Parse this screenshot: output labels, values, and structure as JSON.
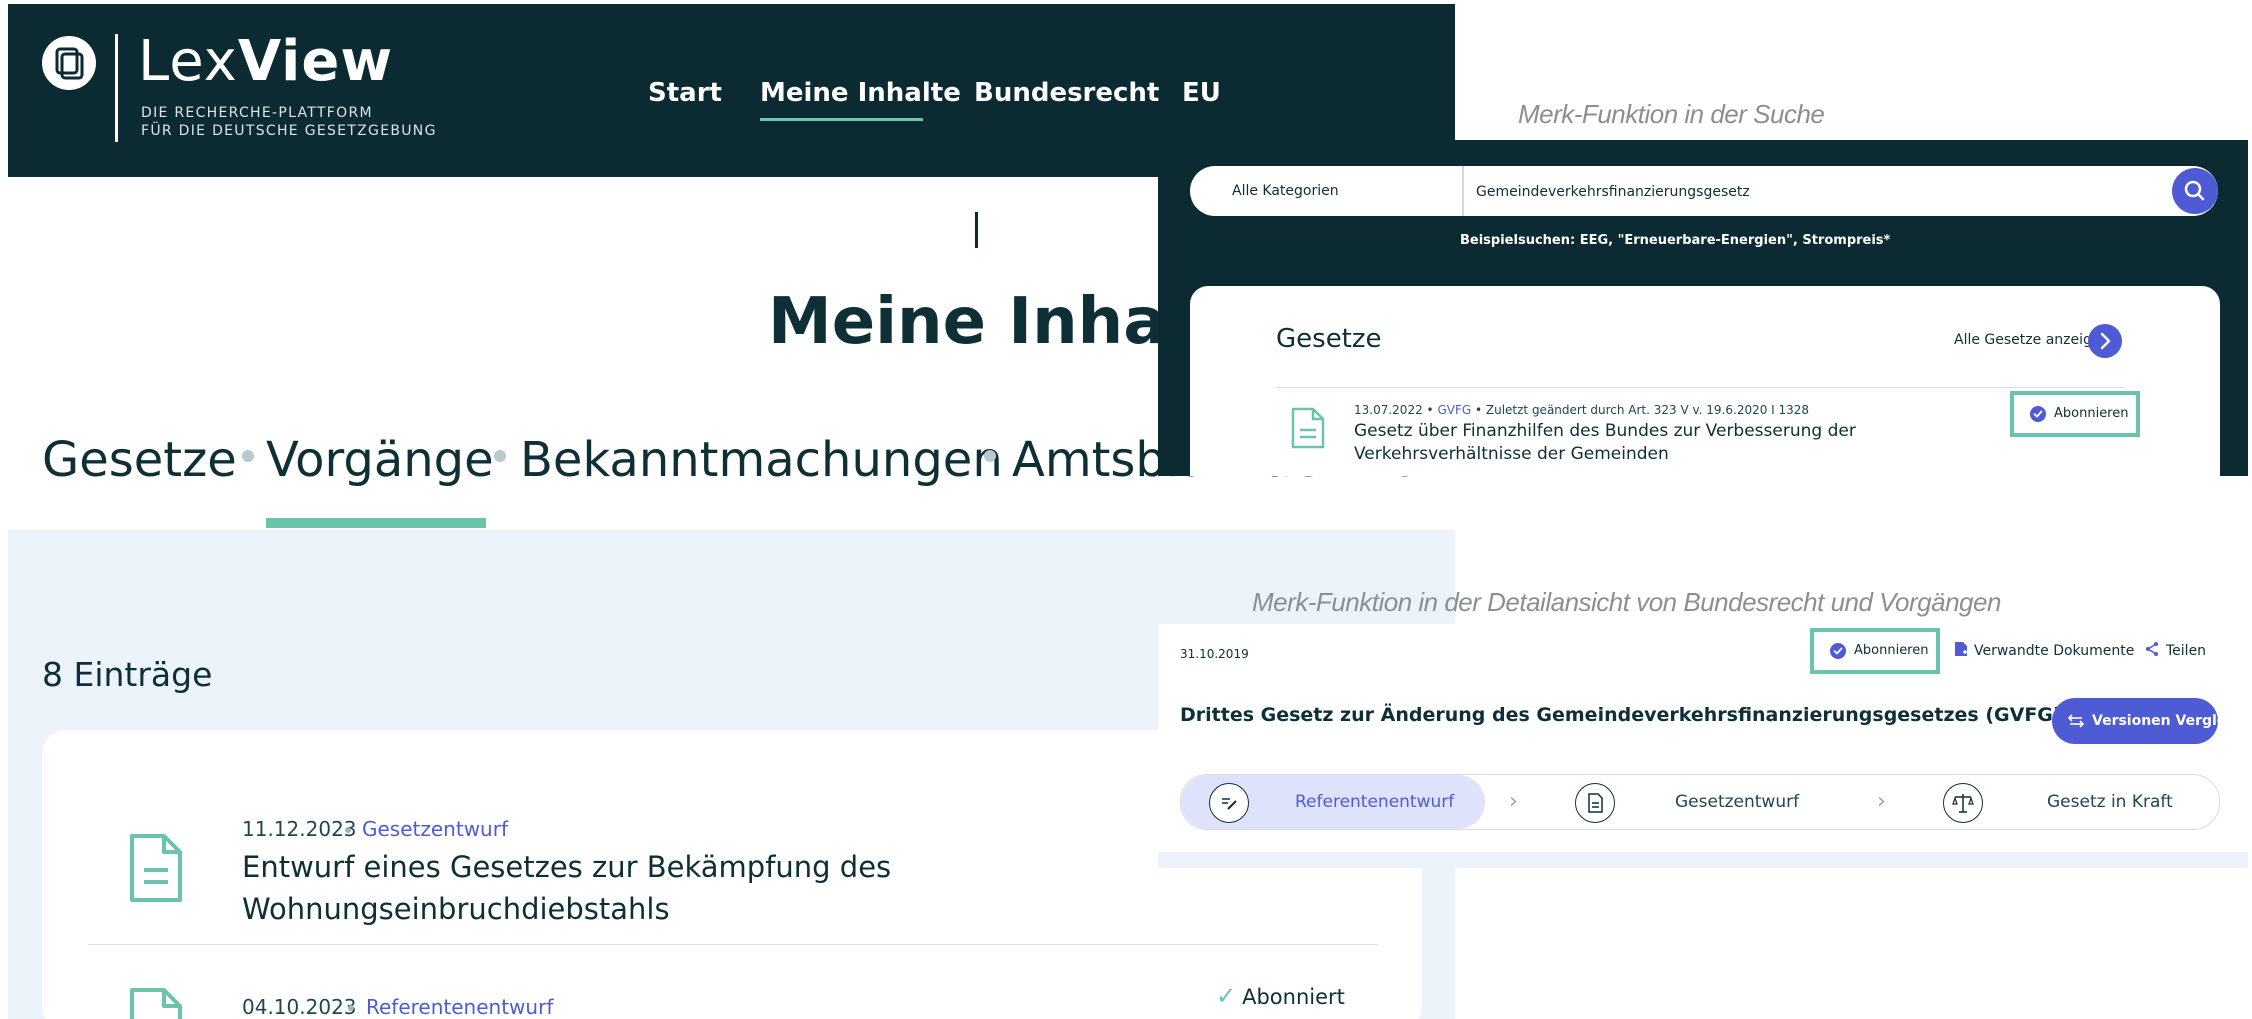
{
  "main": {
    "logo": {
      "word_light": "Lex",
      "word_bold": "View",
      "tagline_1": "DIE RECHERCHE-PLATTFORM",
      "tagline_2": "FÜR DIE DEUTSCHE GESETZGEBUNG"
    },
    "nav": [
      "Start",
      "Meine Inhalte",
      "Bundesrecht",
      "EU"
    ],
    "active_nav": "Meine Inhalte",
    "page_title": "Meine Inhalte",
    "categories": [
      "Gesetze",
      "Vorgänge",
      "Bekanntmachungen",
      "Amtsblatt der EU"
    ],
    "active_category": "Vorgänge",
    "entries_count": "8 Einträge",
    "entries": [
      {
        "date": "11.12.2023",
        "type": "Gesetzentwurf",
        "title_1": "Entwurf eines Gesetzes zur Bekämpfung des",
        "title_2": "Wohnungseinbruchdiebstahls"
      },
      {
        "date": "04.10.2023",
        "type": "Referentenentwurf",
        "status": "Abonniert"
      }
    ]
  },
  "captions": {
    "search": "Merk-Funktion in der Suche",
    "detail": "Merk-Funktion in der Detailansicht von Bundesrecht und Vorgängen"
  },
  "search_overlay": {
    "category": "Alle Kategorien",
    "query": "Gemeindeverkehrsfinanzierungsgesetz",
    "examples": "Beispielsuchen: EEG, \"Erneuerbare-Energien\", Strompreis*",
    "results_heading": "Gesetze",
    "show_all": "Alle Gesetze anzeigen",
    "result": {
      "date": "13.07.2022",
      "abbr": "GVFG",
      "changed": "Zuletzt geändert durch Art. 323 V v. 19.6.2020 I 1328",
      "title": "Gesetz über Finanzhilfen des Bundes zur Verbesserung der Verkehrsverhältnisse der Gemeinden",
      "subscribe": "Abonnieren"
    }
  },
  "detail_overlay": {
    "date": "31.10.2019",
    "subscribe": "Abonnieren",
    "related": "Verwandte Dokumente",
    "share": "Teilen",
    "title": "Drittes Gesetz zur Änderung des Gemeindeverkehrsfinanzierungsgesetzes (GVFG)",
    "compare": "Versionen Vergleich",
    "steps": [
      "Referentenentwurf",
      "Gesetzentwurf",
      "Gesetz in Kraft"
    ],
    "active_step": "Referentenentwurf"
  },
  "colors": {
    "dark": "#0c2a31",
    "accent_green": "#6bc4a9",
    "accent_blue": "#4f5bd5",
    "light_bg": "#edf3fb"
  }
}
